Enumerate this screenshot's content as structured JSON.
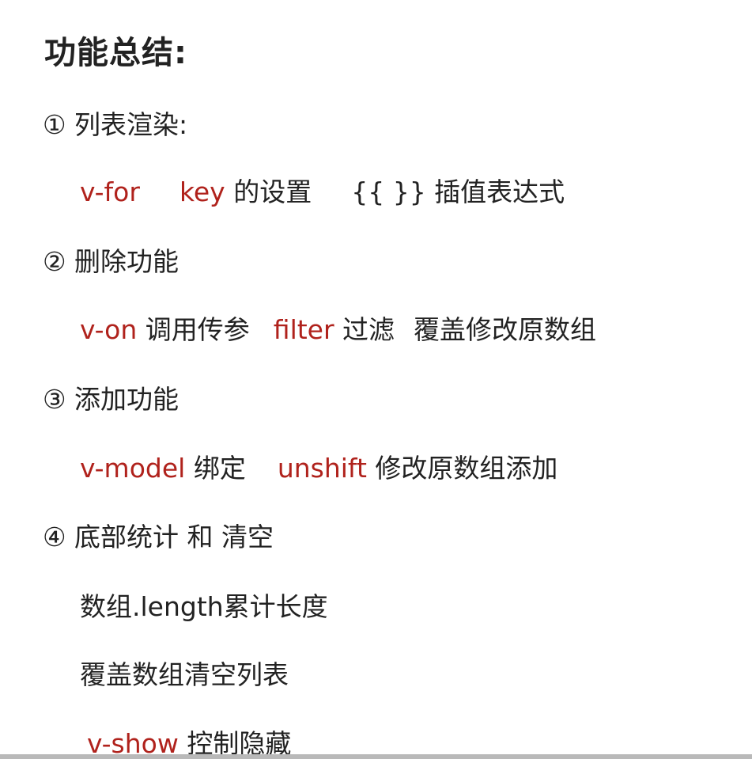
{
  "title": "功能总结:",
  "sections": [
    {
      "num": "①",
      "heading": "列表渲染:",
      "line": {
        "kw1": "v-for",
        "kw2": "key",
        "text2": "的设置",
        "text3": "{{  }} 插值表达式"
      }
    },
    {
      "num": "②",
      "heading": "删除功能",
      "line": {
        "kw1": "v-on",
        "text1": "调用传参",
        "kw2": "filter",
        "text2": "过滤",
        "text3": "覆盖修改原数组"
      }
    },
    {
      "num": "③",
      "heading": "添加功能",
      "line": {
        "kw1": "v-model",
        "text1": "绑定",
        "kw2": "unshift",
        "text2": "修改原数组添加"
      }
    },
    {
      "num": "④",
      "heading": "底部统计 和 清空",
      "lines": [
        "数组.length累计长度",
        "覆盖数组清空列表"
      ],
      "last": {
        "kw": "v-show",
        "text": "控制隐藏"
      }
    }
  ],
  "colors": {
    "keyword": "#b0221c",
    "text": "#222222"
  }
}
